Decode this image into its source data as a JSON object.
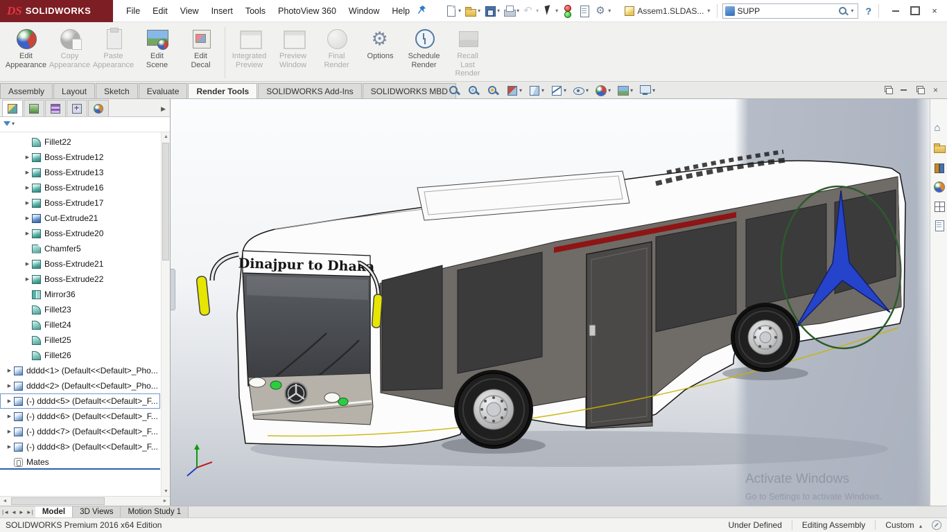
{
  "titlebar": {
    "logo_ds": "DS",
    "logo_text": "SOLIDWORKS",
    "menus": [
      "File",
      "Edit",
      "View",
      "Insert",
      "Tools",
      "PhotoView 360",
      "Window",
      "Help"
    ],
    "qat": [
      {
        "icon": "new-document-icon",
        "cls": "q-new",
        "caret": "▾"
      },
      {
        "icon": "open-icon",
        "cls": "q-open",
        "caret": "▾"
      },
      {
        "icon": "save-icon",
        "cls": "q-save",
        "caret": "▾"
      },
      {
        "icon": "print-icon",
        "cls": "q-print",
        "caret": "▾"
      },
      {
        "icon": "undo-icon",
        "cls": "q-undo",
        "caret": "▾",
        "state": "dim"
      },
      {
        "icon": "select-icon",
        "cls": "q-select",
        "caret": "▾"
      },
      {
        "icon": "rebuild-icon",
        "cls": "q-rebuild",
        "caret": ""
      },
      {
        "icon": "file-properties-icon",
        "cls": "q-props",
        "caret": ""
      },
      {
        "icon": "options-gear-icon",
        "cls": "q-gear",
        "caret": "▾"
      }
    ],
    "document_name": "Assem1.SLDAS...",
    "search_value": "SUPP",
    "help_label": "?"
  },
  "ribbon": {
    "buttons": [
      {
        "label": "Edit\nAppearance"
      },
      {
        "label": "Copy\nAppearance"
      },
      {
        "label": "Paste\nAppearance"
      },
      {
        "label": "Edit\nScene"
      },
      {
        "label": "Edit\nDecal"
      },
      {
        "label": "Integrated\nPreview"
      },
      {
        "label": "Preview\nWindow"
      },
      {
        "label": "Final\nRender"
      },
      {
        "label": "Options"
      },
      {
        "label": "Schedule\nRender"
      },
      {
        "label": "Recall\nLast\nRender"
      }
    ]
  },
  "command_tabs": {
    "items": [
      {
        "label": "Assembly"
      },
      {
        "label": "Layout"
      },
      {
        "label": "Sketch"
      },
      {
        "label": "Evaluate"
      },
      {
        "label": "Render Tools",
        "cls": "active"
      },
      {
        "label": "SOLIDWORKS Add-Ins"
      },
      {
        "label": "SOLIDWORKS MBD"
      }
    ]
  },
  "hud": {
    "items": [
      {
        "icon": "hud-zoom-fit-icon",
        "caret": ""
      },
      {
        "icon": "hud-zoom-area-icon",
        "caret": ""
      },
      {
        "icon": "hud-previous-view-icon",
        "caret": ""
      },
      {
        "icon": "hud-section-view-icon",
        "caret": "▾"
      },
      {
        "icon": "hud-view-orientation-icon",
        "caret": "▾"
      },
      {
        "icon": "hud-display-style-icon",
        "caret": "▾"
      },
      {
        "icon": "hud-hide-show-icon",
        "caret": "▾"
      },
      {
        "icon": "hud-edit-appearance-icon",
        "caret": "▾"
      },
      {
        "icon": "hud-scene-icon",
        "caret": "▾"
      },
      {
        "icon": "hud-view-settings-icon",
        "caret": "▾"
      }
    ]
  },
  "fmpanel": {
    "tabs": [
      {
        "icon": "featuremanager-tab-icon",
        "cls": "fm-tree-tab-icon",
        "active": "active"
      },
      {
        "icon": "propertymanager-tab-icon",
        "cls": "fm-property-tab-icon",
        "active": ""
      },
      {
        "icon": "configurationmanager-tab-icon",
        "cls": "fm-configuration-tab-icon",
        "active": ""
      },
      {
        "icon": "dimxpertmanager-tab-icon",
        "cls": "fm-dimxpert-tab-icon",
        "active": ""
      },
      {
        "icon": "displaymanager-tab-icon",
        "cls": "fm-display-manager-tab-icon",
        "active": ""
      }
    ],
    "overflow_arrow": "▶",
    "filter_caret": "▾",
    "scroll_up": "▲",
    "scroll_down": "▼",
    "scroll_left": "◄",
    "scroll_right": "►"
  },
  "tree": {
    "items": [
      {
        "arrow": "",
        "icon": "fillet-feature-icon",
        "ic": "ic-fillet",
        "label": "Fillet22",
        "cls": "lv2"
      },
      {
        "arrow": "▶",
        "icon": "boss-extrude-feature-icon",
        "ic": "ic-boss",
        "label": "Boss-Extrude12",
        "cls": "lv2"
      },
      {
        "arrow": "▶",
        "icon": "boss-extrude-feature-icon",
        "ic": "ic-boss",
        "label": "Boss-Extrude13",
        "cls": "lv2"
      },
      {
        "arrow": "▶",
        "icon": "boss-extrude-feature-icon",
        "ic": "ic-boss",
        "label": "Boss-Extrude16",
        "cls": "lv2"
      },
      {
        "arrow": "▶",
        "icon": "boss-extrude-feature-icon",
        "ic": "ic-boss",
        "label": "Boss-Extrude17",
        "cls": "lv2"
      },
      {
        "arrow": "▶",
        "icon": "cut-extrude-feature-icon",
        "ic": "ic-cut",
        "label": "Cut-Extrude21",
        "cls": "lv2"
      },
      {
        "arrow": "▶",
        "icon": "boss-extrude-feature-icon",
        "ic": "ic-boss",
        "label": "Boss-Extrude20",
        "cls": "lv2"
      },
      {
        "arrow": "",
        "icon": "chamfer-feature-icon",
        "ic": "ic-chamfer",
        "label": "Chamfer5",
        "cls": "lv2"
      },
      {
        "arrow": "▶",
        "icon": "boss-extrude-feature-icon",
        "ic": "ic-boss",
        "label": "Boss-Extrude21",
        "cls": "lv2"
      },
      {
        "arrow": "▶",
        "icon": "boss-extrude-feature-icon",
        "ic": "ic-boss",
        "label": "Boss-Extrude22",
        "cls": "lv2"
      },
      {
        "arrow": "",
        "icon": "mirror-feature-icon",
        "ic": "ic-mirror",
        "label": "Mirror36",
        "cls": "lv2"
      },
      {
        "arrow": "",
        "icon": "fillet-feature-icon",
        "ic": "ic-fillet",
        "label": "Fillet23",
        "cls": "lv2"
      },
      {
        "arrow": "",
        "icon": "fillet-feature-icon",
        "ic": "ic-fillet",
        "label": "Fillet24",
        "cls": "lv2"
      },
      {
        "arrow": "",
        "icon": "fillet-feature-icon",
        "ic": "ic-fillet",
        "label": "Fillet25",
        "cls": "lv2"
      },
      {
        "arrow": "",
        "icon": "fillet-feature-icon",
        "ic": "ic-fillet",
        "label": "Fillet26",
        "cls": "lv2"
      },
      {
        "arrow": "▶",
        "icon": "component-icon",
        "ic": "ic-comp",
        "label": "dddd<1> (Default<<Default>_Pho...",
        "cls": "lv1"
      },
      {
        "arrow": "▶",
        "icon": "component-icon",
        "ic": "ic-comp",
        "label": "dddd<2> (Default<<Default>_Pho...",
        "cls": "lv1"
      },
      {
        "arrow": "▶",
        "icon": "component-icon",
        "ic": "ic-comp",
        "label": "(-) dddd<5> (Default<<Default>_F...",
        "cls": "lv1 focused"
      },
      {
        "arrow": "▶",
        "icon": "component-icon",
        "ic": "ic-comp",
        "label": "(-) dddd<6> (Default<<Default>_F...",
        "cls": "lv1"
      },
      {
        "arrow": "▶",
        "icon": "component-icon",
        "ic": "ic-comp",
        "label": "(-) dddd<7> (Default<<Default>_F...",
        "cls": "lv1"
      },
      {
        "arrow": "▶",
        "icon": "component-icon",
        "ic": "ic-comp",
        "label": "(-) dddd<8> (Default<<Default>_F...",
        "cls": "lv1"
      },
      {
        "arrow": "",
        "icon": "mates-folder-icon",
        "ic": "ic-mates",
        "label": "Mates",
        "cls": "lv1 matesline"
      }
    ]
  },
  "taskpane": {
    "items": [
      {
        "icon": "solidworks-resources-icon",
        "cls": "tp-home"
      },
      {
        "icon": "file-explorer-icon",
        "cls": "tp-folder"
      },
      {
        "icon": "design-library-icon",
        "cls": "tp-library"
      },
      {
        "icon": "appearances-scenes-icon",
        "cls": "tp-ball"
      },
      {
        "icon": "view-palette-icon",
        "cls": "tp-palette"
      },
      {
        "icon": "custom-properties-icon",
        "cls": "tp-props"
      }
    ]
  },
  "viewport": {
    "decal_text": "Dinajpur to Dhaka",
    "watermark_title": "Activate Windows",
    "watermark_subtitle": "Go to Settings to activate Windows."
  },
  "doctabs": {
    "nav": [
      "|◄",
      "◄",
      "►",
      "►|"
    ],
    "items": [
      {
        "label": "Model",
        "cls": "active"
      },
      {
        "label": "3D Views"
      },
      {
        "label": "Motion Study 1"
      }
    ]
  },
  "statusbar": {
    "app_version": "SOLIDWORKS Premium 2016 x64 Edition",
    "assembly_status": "Under Defined",
    "mode": "Editing Assembly",
    "units": "Custom",
    "units_caret": "▴"
  },
  "colors": {
    "logo_background": "#7d1e24",
    "logo_red": "#e23640",
    "stripe_red": "#8e1515",
    "star_blue": "#2544cb",
    "emblem_green": "#2c5b2c",
    "mirror_yellow": "#e6e600",
    "headlight_green": "#2ecc40",
    "selection_blue": "#2b5fad",
    "watermark_gray": "#8a939e"
  }
}
